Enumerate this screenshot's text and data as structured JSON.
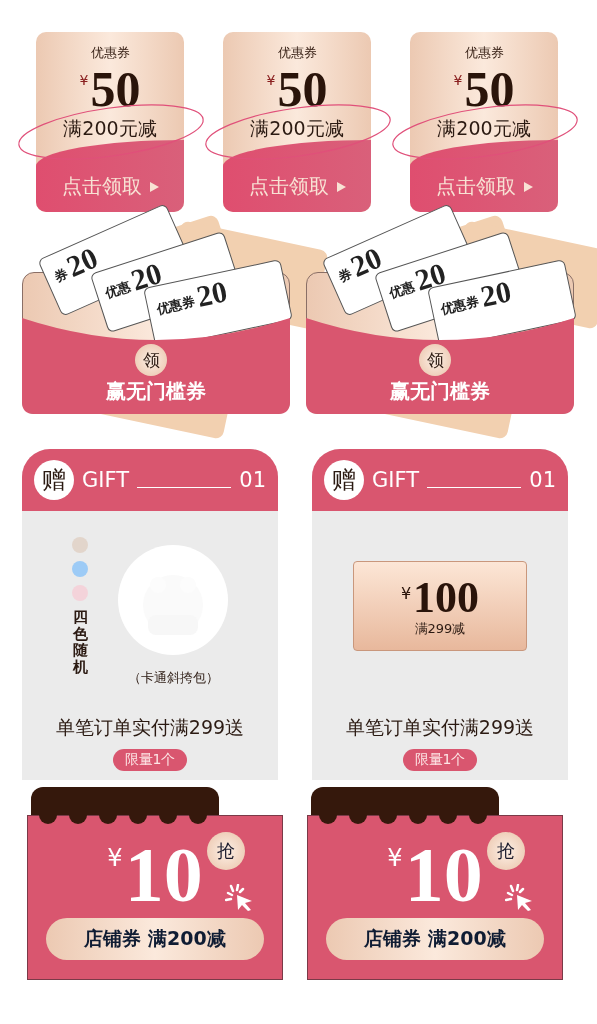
{
  "coupons": [
    {
      "label": "优惠券",
      "currency": "¥",
      "amount": "50",
      "condition": "满200元减",
      "action": "点击领取"
    },
    {
      "label": "优惠券",
      "currency": "¥",
      "amount": "50",
      "condition": "满200元减",
      "action": "点击领取"
    },
    {
      "label": "优惠券",
      "currency": "¥",
      "amount": "50",
      "condition": "满200元减",
      "action": "点击领取"
    }
  ],
  "envelopes": [
    {
      "tickets": [
        {
          "label": "券",
          "amount": "20"
        },
        {
          "label": "优惠",
          "amount": "20"
        },
        {
          "label": "优惠券",
          "amount": "20"
        }
      ],
      "badge": "领",
      "title": "赢无门槛券"
    },
    {
      "tickets": [
        {
          "label": "券",
          "amount": "20"
        },
        {
          "label": "优惠",
          "amount": "20"
        },
        {
          "label": "优惠券",
          "amount": "20"
        }
      ],
      "badge": "领",
      "title": "赢无门槛券"
    }
  ],
  "gifts": [
    {
      "kind": "swatches",
      "badge": "赠",
      "title": "GIFT",
      "number": "01",
      "swatches": [
        {
          "color": "#e2d5cb"
        },
        {
          "color": "#9dcbf6"
        },
        {
          "color": "#f4d3da"
        }
      ],
      "note": "四色随机",
      "caption": "（卡通斜挎包）",
      "description": "单笔订单实付满299送",
      "tag": "限量1个"
    },
    {
      "kind": "voucher",
      "badge": "赠",
      "title": "GIFT",
      "number": "01",
      "currency": "¥",
      "amount": "100",
      "condition": "满299减",
      "description": "单笔订单实付满299送",
      "tag": "限量1个"
    }
  ],
  "store_coupons": [
    {
      "currency": "¥",
      "amount": "10",
      "grab": "抢",
      "label": "店铺券 满200减"
    },
    {
      "currency": "¥",
      "amount": "10",
      "grab": "抢",
      "label": "店铺券 满200减"
    }
  ]
}
